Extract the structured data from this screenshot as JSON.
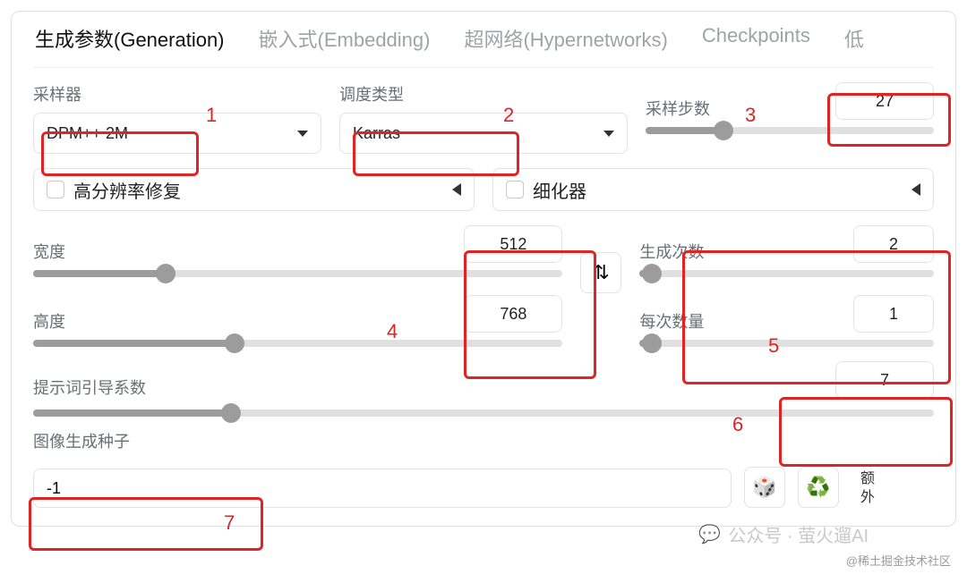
{
  "tabs": [
    "生成参数(Generation)",
    "嵌入式(Embedding)",
    "超网络(Hypernetworks)",
    "Checkpoints",
    "低"
  ],
  "sampler": {
    "label": "采样器",
    "value": "DPM++ 2M"
  },
  "scheduler": {
    "label": "调度类型",
    "value": "Karras"
  },
  "steps": {
    "label": "采样步数",
    "value": "27",
    "pct": 27
  },
  "hires": {
    "label": "高分辨率修复"
  },
  "refiner": {
    "label": "细化器"
  },
  "width": {
    "label": "宽度",
    "value": "512",
    "pct": 25
  },
  "height": {
    "label": "高度",
    "value": "768",
    "pct": 38
  },
  "batch_count": {
    "label": "生成次数",
    "value": "2",
    "pct": 4
  },
  "batch_size": {
    "label": "每次数量",
    "value": "1",
    "pct": 4
  },
  "cfg": {
    "label": "提示词引导系数",
    "value": "7",
    "pct": 22
  },
  "seed": {
    "label": "图像生成种子",
    "value": "-1"
  },
  "extra": {
    "label1": "额",
    "label2": "外"
  },
  "icons": {
    "dice": "🎲",
    "recycle": "♻️",
    "swap": "⇅"
  },
  "annotations": [
    "1",
    "2",
    "3",
    "4",
    "5",
    "6",
    "7"
  ],
  "wm1": "公众号 · 萤火遛AI",
  "wm2": "@稀土掘金技术社区"
}
